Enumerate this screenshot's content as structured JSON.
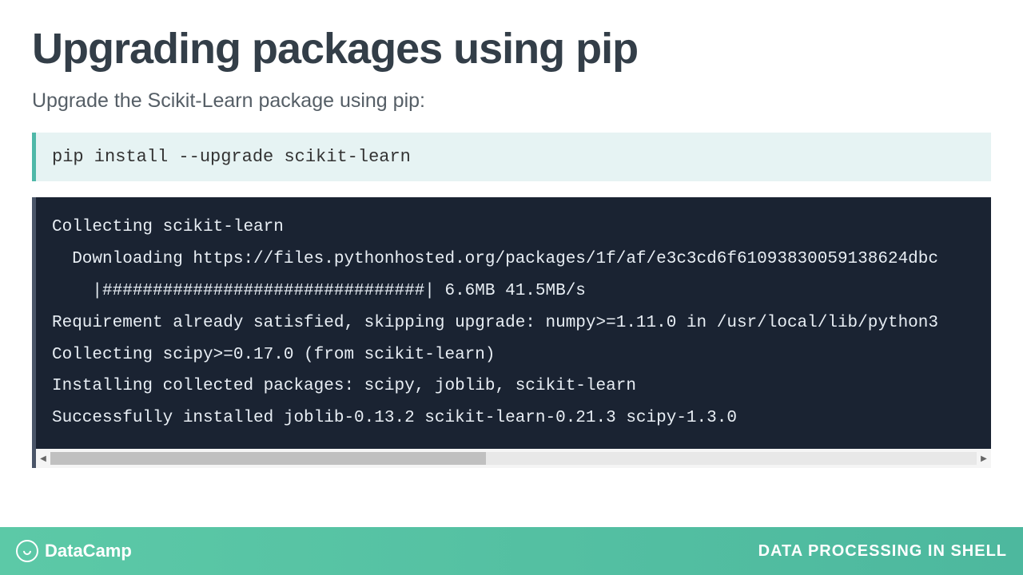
{
  "title": "Upgrading packages using pip",
  "subtitle": "Upgrade the Scikit-Learn package using pip:",
  "command": "pip install --upgrade scikit-learn",
  "output": "Collecting scikit-learn\n  Downloading https://files.pythonhosted.org/packages/1f/af/e3c3cd6f61093830059138624dbc\n    |################################| 6.6MB 41.5MB/s\nRequirement already satisfied, skipping upgrade: numpy>=1.11.0 in /usr/local/lib/python3\nCollecting scipy>=0.17.0 (from scikit-learn)\nInstalling collected packages: scipy, joblib, scikit-learn\nSuccessfully installed joblib-0.13.2 scikit-learn-0.21.3 scipy-1.3.0",
  "footer": {
    "brand": "DataCamp",
    "course": "DATA PROCESSING IN SHELL"
  }
}
